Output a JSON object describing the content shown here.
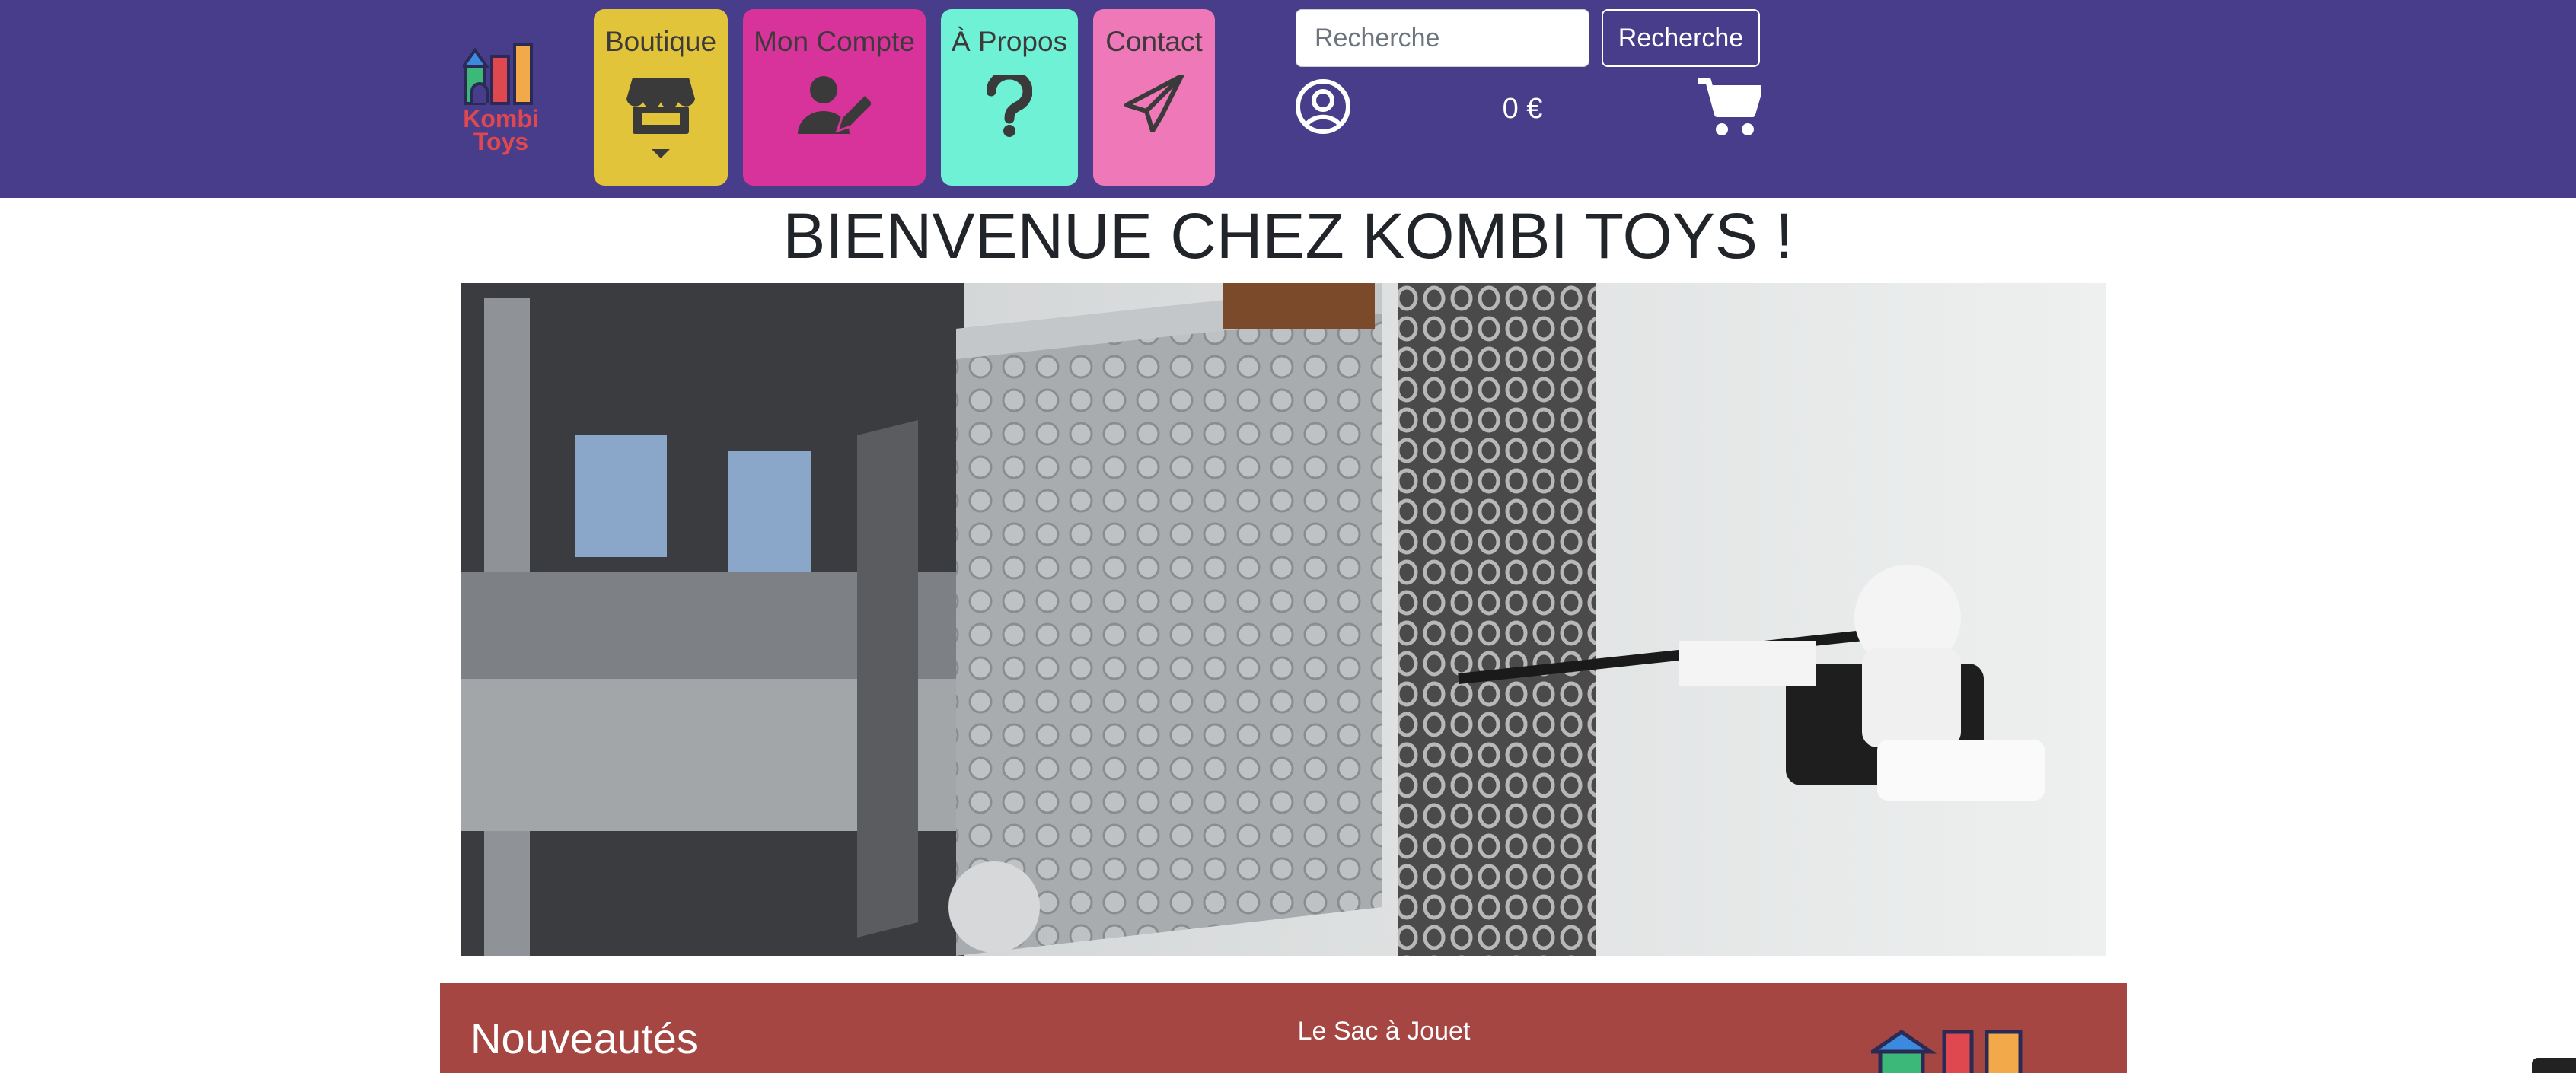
{
  "header": {
    "logo": {
      "line1": "Kombi",
      "line2": "Toys"
    },
    "nav": [
      {
        "label": "Boutique",
        "icon": "store-icon"
      },
      {
        "label": "Mon Compte",
        "icon": "user-edit-icon"
      },
      {
        "label": "À Propos",
        "icon": "question-icon"
      },
      {
        "label": "Contact",
        "icon": "paper-plane-icon"
      }
    ],
    "search": {
      "placeholder": "Recherche",
      "value": "",
      "button_label": "Recherche"
    },
    "account_icon": "user-circle-icon",
    "cart": {
      "total": "0 €",
      "icon": "shopping-cart-icon"
    }
  },
  "main": {
    "title": "BIENVENUE CHEZ KOMBI TOYS !",
    "hero_image": "lego-walker-photo"
  },
  "news": {
    "title": "Nouveautés",
    "subtitle": "Le Sac à Jouet"
  },
  "colors": {
    "header_bg": "#483d8b",
    "boutique": "#e2c43a",
    "compte": "#d8339a",
    "apropos": "#6ff1d6",
    "contact": "#ee78b8",
    "news_bg": "#a64642",
    "logo_text": "#e0484f"
  }
}
